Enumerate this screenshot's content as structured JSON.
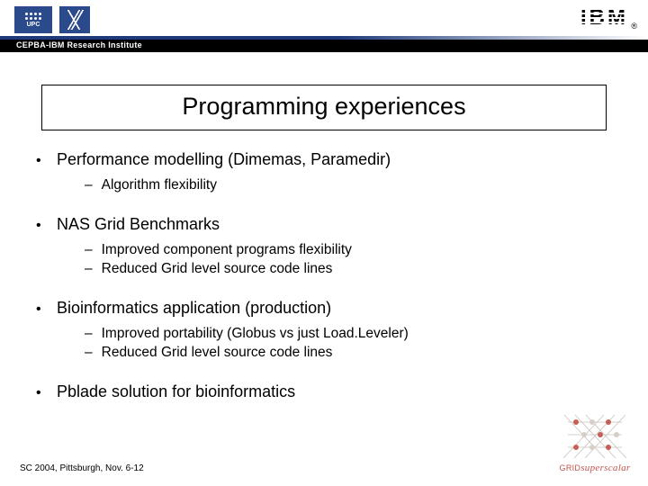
{
  "header": {
    "upc_text": "UPC",
    "institute_bar": "CEPBA-IBM Research Institute",
    "ibm_text": "IBM",
    "ibm_reg": "®"
  },
  "title": "Programming experiences",
  "bullets": [
    {
      "text": "Performance modelling (Dimemas, Paramedir)",
      "subs": [
        "Algorithm flexibility"
      ]
    },
    {
      "text": "NAS Grid Benchmarks",
      "subs": [
        "Improved component programs flexibility",
        "Reduced Grid level source code lines"
      ]
    },
    {
      "text": "Bioinformatics application (production)",
      "subs": [
        "Improved portability (Globus vs just Load.Leveler)",
        "Reduced Grid level source code lines"
      ]
    },
    {
      "text": "Pblade solution for bioinformatics",
      "subs": []
    }
  ],
  "footer": "SC 2004, Pittsburgh, Nov. 6-12",
  "corner": {
    "grid": "GRID",
    "ss": "superscalar"
  }
}
